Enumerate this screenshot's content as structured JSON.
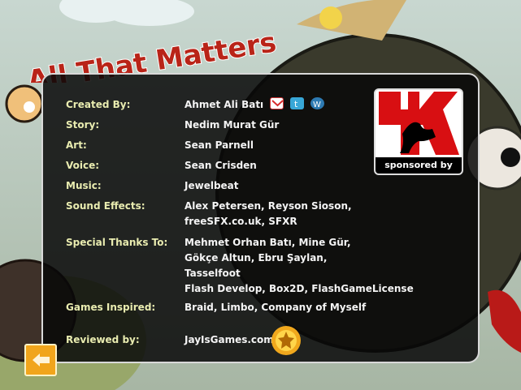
{
  "game_title": "All That Matters",
  "credits": [
    {
      "label": "Created By:",
      "value": [
        "Ahmet Ali Batı"
      ]
    },
    {
      "label": "Story:",
      "value": [
        "Nedim Murat Gür"
      ]
    },
    {
      "label": "Art:",
      "value": [
        "Sean Parnell"
      ]
    },
    {
      "label": "Voice:",
      "value": [
        "Sean Crisden"
      ]
    },
    {
      "label": "Music:",
      "value": [
        "Jewelbeat"
      ]
    },
    {
      "label": "Sound Effects:",
      "value": [
        "Alex Petersen, Reyson Sioson,",
        "freeSFX.co.uk, SFXR"
      ]
    },
    {
      "label": "Special Thanks To:",
      "value": [
        "Mehmet Orhan Batı, Mine Gür,",
        "Gökçe Altun, Ebru Şaylan,",
        "Tasselfoot",
        "Flash Develop, Box2D, FlashGameLicense"
      ]
    },
    {
      "label": "Games Inspired:",
      "value": [
        "Braid, Limbo, Company of Myself"
      ]
    },
    {
      "label": "Reviewed by:",
      "value": [
        "JayIsGames.com"
      ]
    }
  ],
  "social_icons": [
    "gmail-icon",
    "twitter-icon",
    "wordpress-icon"
  ],
  "sponsor": {
    "label": "sponsored by",
    "logo": "TK"
  },
  "colors": {
    "label": "#e9ecb0",
    "value": "#f4f4f4",
    "accent": "#f1a51c"
  }
}
